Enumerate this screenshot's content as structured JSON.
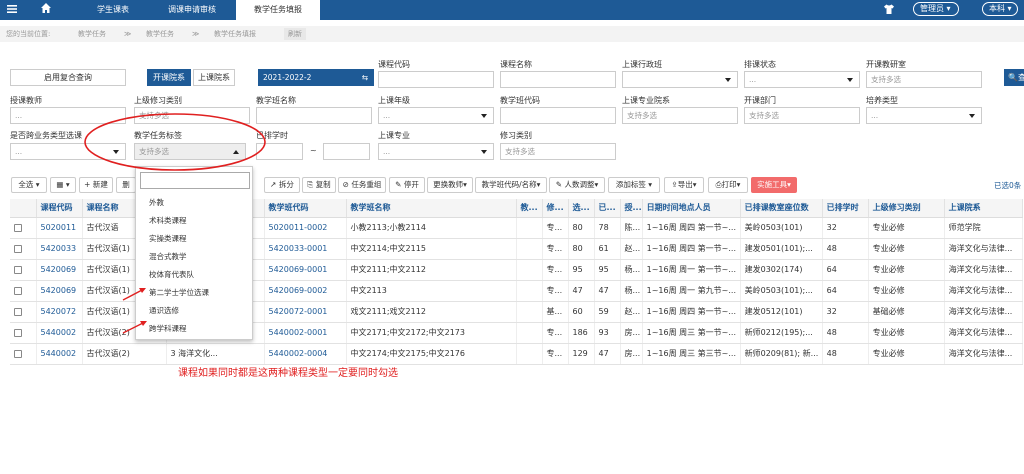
{
  "topnav": {
    "tabs": [
      "学生课表",
      "调课申请审核",
      "教学任务填报"
    ],
    "admin": "管理员",
    "level": "本科"
  },
  "breadcrumb": {
    "prefix": "您的当前位置:",
    "items": [
      "教学任务",
      "教学任务",
      "教学任务填报"
    ],
    "refresh": "刷新"
  },
  "filters": {
    "complex_query": "启用复合查询",
    "open_dept": "开课院系",
    "course_dept": "上课院系",
    "term": "2021-2022-2",
    "course_code": "课程代码",
    "course_name": "课程名称",
    "admin_class": "上课行政班",
    "schedule_status": "排课状态",
    "research": "开课教研室",
    "multi": "支持多选",
    "ellipsis": "...",
    "teacher": "授课教师",
    "parent_type": "上级修习类别",
    "class_name": "教学班名称",
    "grade": "上课年级",
    "class_code": "教学班代码",
    "major": "上课专业院系",
    "open_unit": "开课部门",
    "training_type": "培养类型",
    "cross_type": "是否跨业务类型选课",
    "task_tag": "教学任务标签",
    "sched_time": "已排学时",
    "tilde": "~",
    "major2": "上课专业",
    "study_type": "修习类别",
    "query_btn": "查"
  },
  "toolbar": {
    "all": "全选",
    "new": "新建",
    "del": "删",
    "split": "拆分",
    "copy": "复制",
    "regroup": "任务重组",
    "stop": "停开",
    "change_teacher": "更换教师",
    "class_code_name": "教学班代码/名称",
    "count_adjust": "人数调整",
    "add_tag": "添加标签",
    "export": "导出",
    "print": "打印",
    "tools": "实施工具",
    "selected": "已选0条"
  },
  "table": {
    "headers": [
      "课程代码",
      "课程名称",
      "",
      "教学班代码",
      "教学班名称",
      "教...",
      "修...",
      "选...",
      "已...",
      "授...",
      "日期时间地点人员",
      "已排课教室座位数",
      "已排学时",
      "上级修习类别",
      "上课院系"
    ],
    "rows": [
      [
        "5020011",
        "古代汉语",
        "",
        "5020011-0002",
        "小教2113;小教2114",
        "",
        "专...",
        "80",
        "78",
        "陈...",
        "1~16周 周四 第一节~...",
        "美岭0503(101)",
        "32",
        "专业必修",
        "师范学院"
      ],
      [
        "5420033",
        "古代汉语(1)",
        "",
        "5420033-0001",
        "中文2114;中文2115",
        "",
        "专...",
        "80",
        "61",
        "赵...",
        "1~16周 周四 第一节~...",
        "建发0501(101);...",
        "48",
        "专业必修",
        "海洋文化与法律..."
      ],
      [
        "5420069",
        "古代汉语(1)",
        "",
        "5420069-0001",
        "中文2111;中文2112",
        "",
        "专...",
        "95",
        "95",
        "杨...",
        "1~16周 周一 第一节~...",
        "建发0302(174)",
        "64",
        "专业必修",
        "海洋文化与法律..."
      ],
      [
        "5420069",
        "古代汉语(1)",
        "",
        "5420069-0002",
        "中文2113",
        "",
        "专...",
        "47",
        "47",
        "杨...",
        "1~16周 周一 第九节~...",
        "美岭0503(101);...",
        "64",
        "专业必修",
        "海洋文化与法律..."
      ],
      [
        "5420072",
        "古代汉语(1)",
        "",
        "5420072-0001",
        "戏文2111;戏文2112",
        "",
        "基...",
        "60",
        "59",
        "赵...",
        "1~16周 周四 第一节~...",
        "建发0512(101)",
        "32",
        "基础必修",
        "海洋文化与法律..."
      ],
      [
        "5440002",
        "古代汉语(2)",
        "",
        "5440002-0001",
        "中文2171;中文2172;中文2173",
        "",
        "专...",
        "186",
        "93",
        "房...",
        "1~16周 周三 第一节~...",
        "新师0212(195);...",
        "48",
        "专业必修",
        "海洋文化与法律..."
      ],
      [
        "5440002",
        "古代汉语(2)",
        "3  海洋文化...",
        "5440002-0004",
        "中文2174;中文2175;中文2176",
        "",
        "专...",
        "129",
        "47",
        "房...",
        "1~16周 周三 第三节~...",
        "新师0209(81); 新...",
        "48",
        "专业必修",
        "海洋文化与法律..."
      ]
    ]
  },
  "dropdown": {
    "placeholder": "支持多选",
    "options": [
      "外教",
      "术科类课程",
      "实操类课程",
      "混合式教学",
      "校体育代表队",
      "第二学士学位选课",
      "通识选修",
      "跨学科课程"
    ]
  },
  "annotation": "课程如果同时都是这两种课程类型一定要同时勾选",
  "colors": {
    "nav": "#1e5a96",
    "red": "#e02020",
    "accent": "#1e5a96"
  }
}
